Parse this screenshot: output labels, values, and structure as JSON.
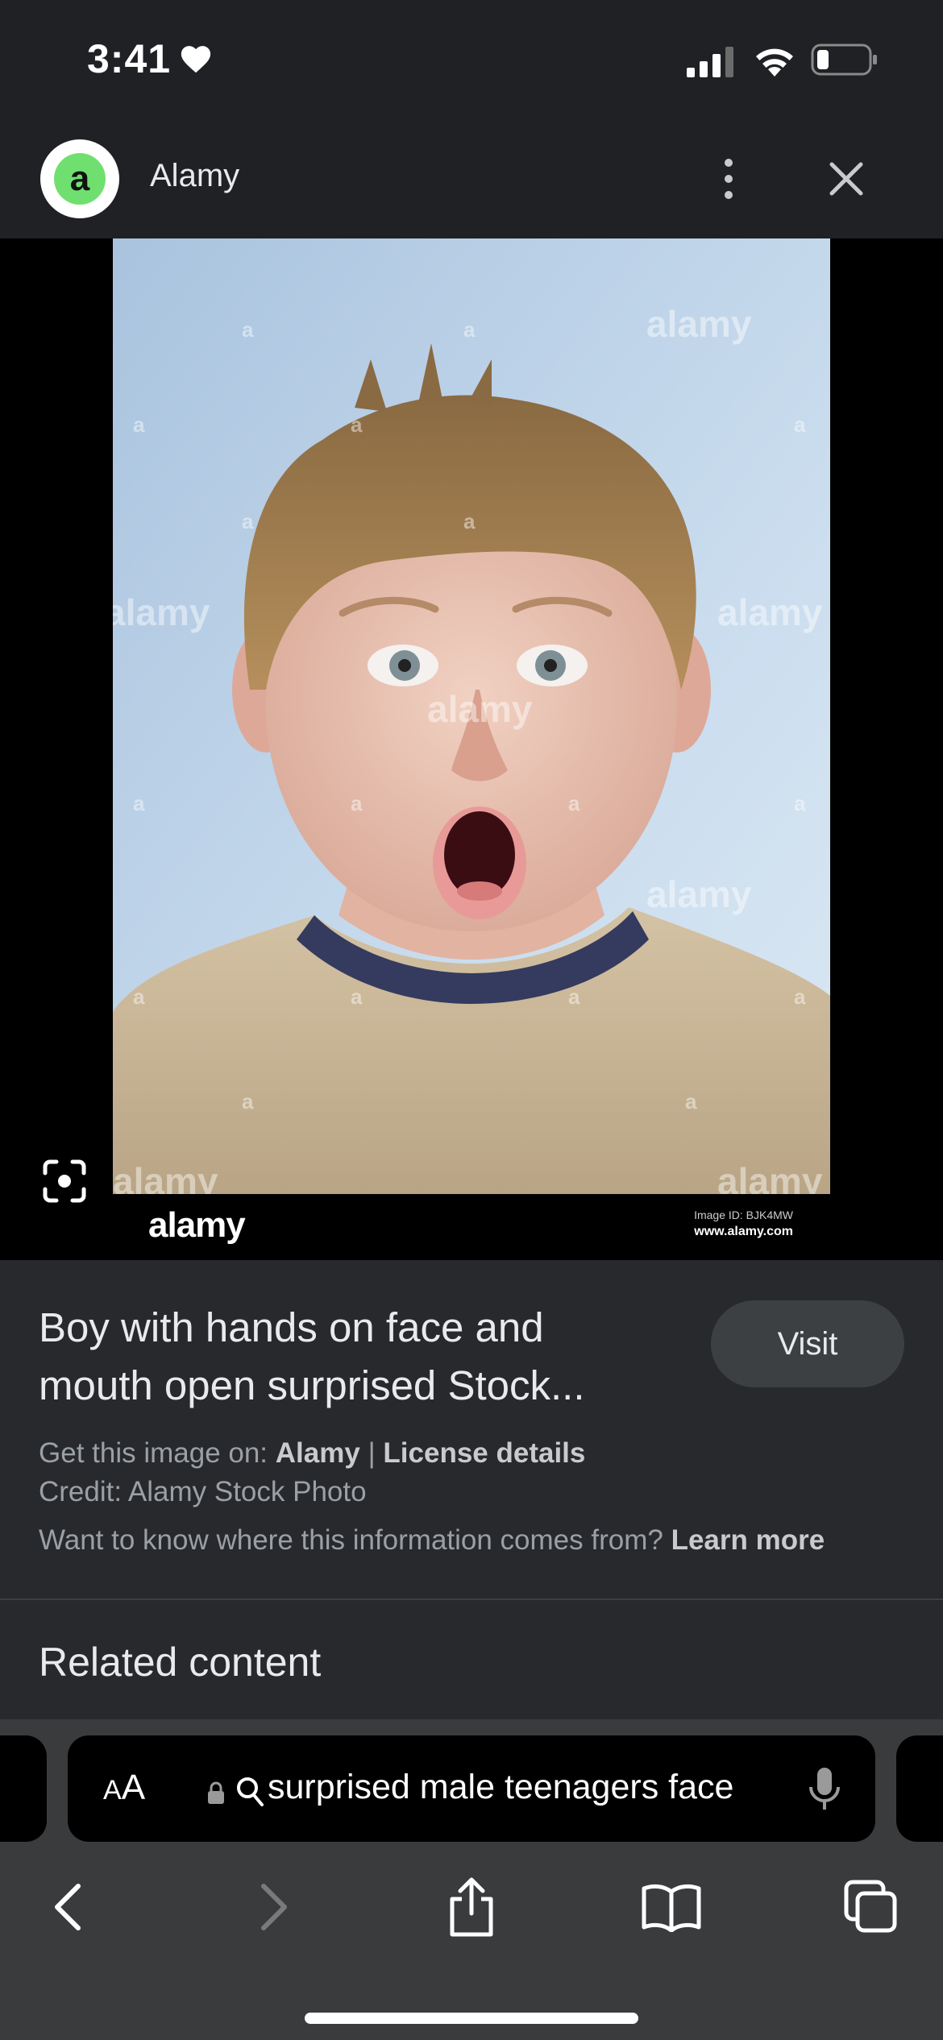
{
  "status_bar": {
    "time": "3:41",
    "icons": [
      "heart-icon",
      "cellular-signal-icon",
      "wifi-icon",
      "battery-icon"
    ]
  },
  "header": {
    "logo_letter": "a",
    "site_name": "Alamy",
    "more_icon": "more-vertical-icon",
    "close_icon": "close-icon"
  },
  "image": {
    "watermark_text": "alamy",
    "watermark_letter": "a",
    "footer_logo": "alamy",
    "image_id": "Image ID: BJK4MW",
    "url": "www.alamy.com",
    "lens_icon": "lens-icon"
  },
  "info": {
    "title": "Boy with hands on face and mouth open surprised Stock...",
    "visit_label": "Visit",
    "get_image_prefix": "Get this image on:",
    "source_link": "Alamy",
    "separator": "|",
    "license_link": "License details",
    "credit": "Credit: Alamy Stock Photo",
    "info_question": "Want to know where this information comes from?",
    "learn_more": "Learn more",
    "related_heading": "Related content"
  },
  "browser": {
    "aa_label_big": "A",
    "aa_label_small": "A",
    "address": "surprised male teenagers face",
    "toolbar": [
      "back-icon",
      "forward-icon",
      "share-icon",
      "bookmarks-icon",
      "tabs-icon"
    ]
  },
  "colors": {
    "background": "#202124",
    "info_panel": "#28292c",
    "visit_button": "#3c4043",
    "logo_green": "#6fe06f",
    "chrome": "#3a3b3d"
  }
}
